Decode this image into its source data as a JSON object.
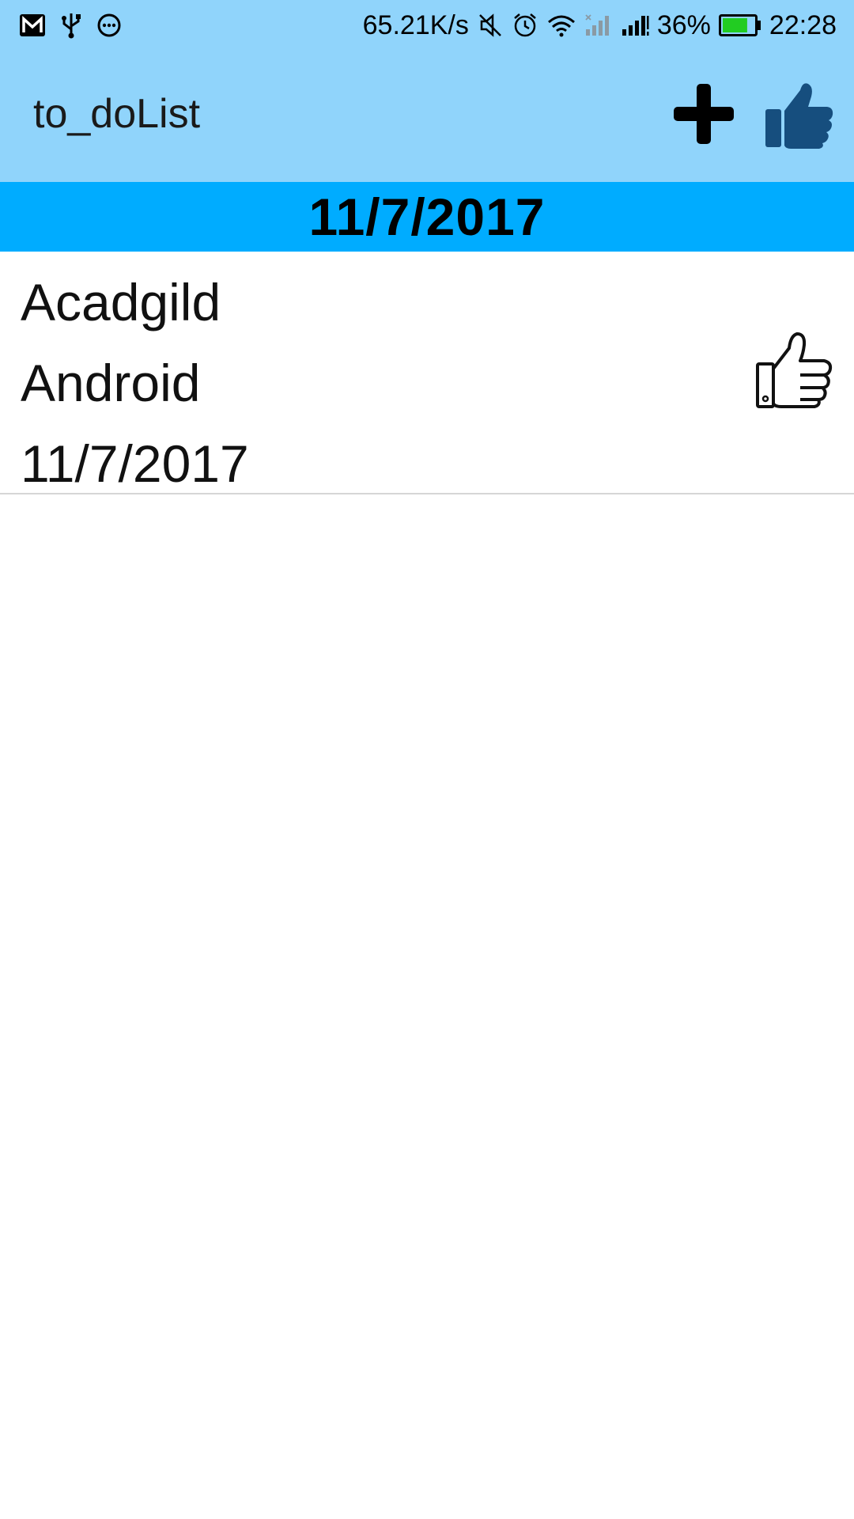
{
  "status_bar": {
    "network_speed": "65.21K/s",
    "battery_percent": "36%",
    "battery_level": 0.36,
    "time": "22:28",
    "left_icons": [
      "gmail-icon",
      "usb-icon",
      "chat-icon"
    ],
    "right_icons": [
      "mute-icon",
      "alarm-icon",
      "wifi-icon",
      "signal-no-sim-icon",
      "signal-icon",
      "battery-icon"
    ]
  },
  "app_bar": {
    "title": "to_doList",
    "actions": [
      "add-icon",
      "thumbs-up-icon"
    ],
    "background_color": "#90d4fb"
  },
  "date_header": {
    "label": "11/7/2017",
    "background_color": "#00acff"
  },
  "todo_items": [
    {
      "title": "Acadgild",
      "description": "Android",
      "date": "11/7/2017",
      "action_icon": "thumbs-up-outline-icon"
    }
  ]
}
